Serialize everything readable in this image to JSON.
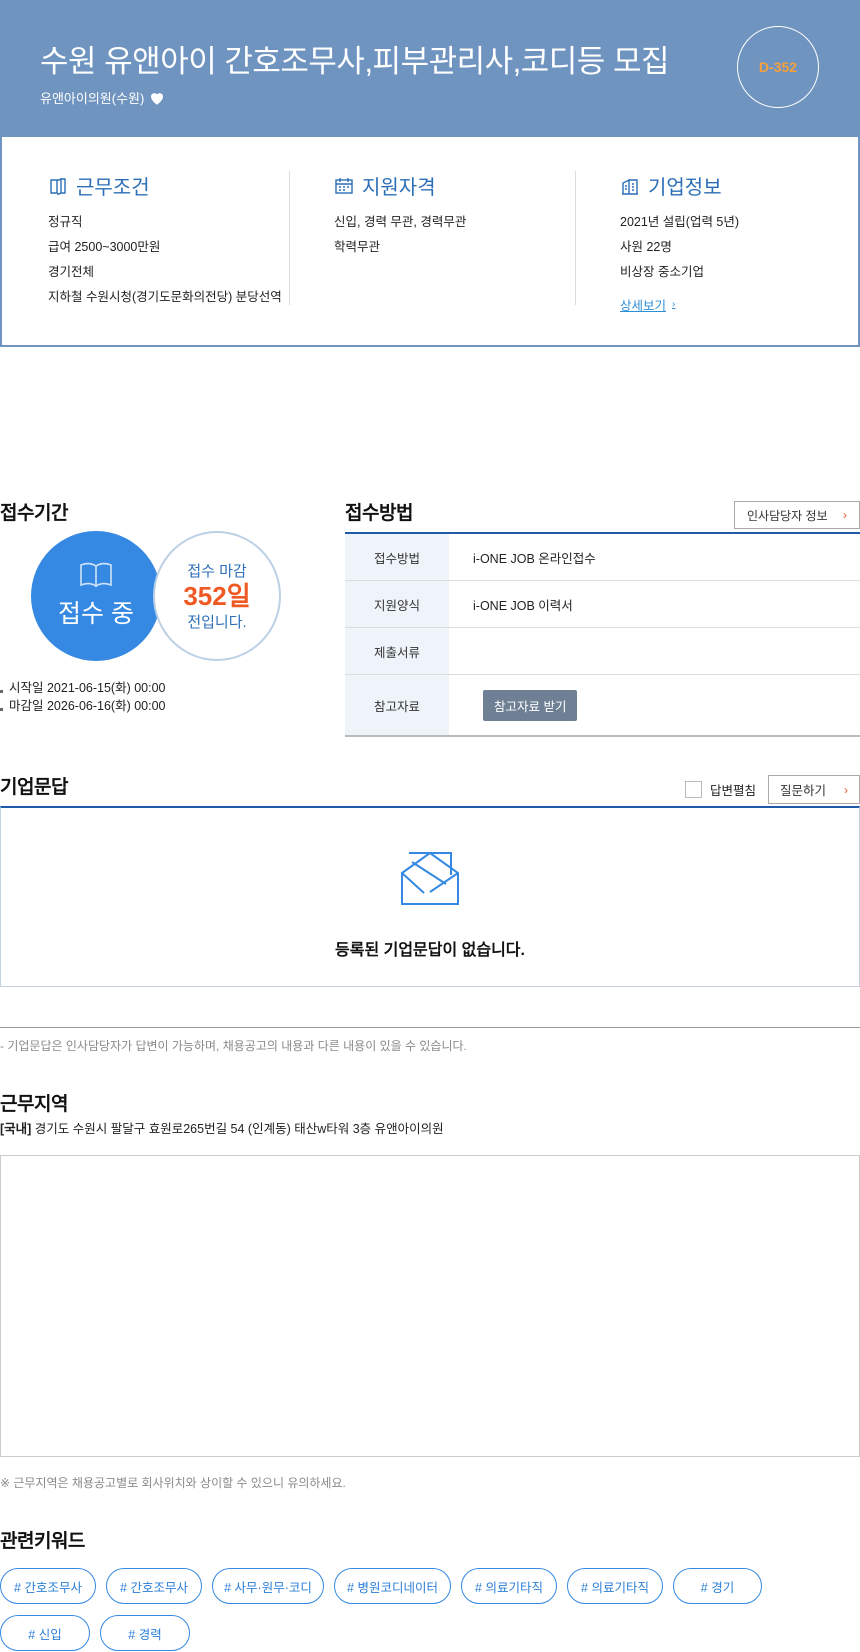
{
  "header": {
    "title": "수원 유앤아이 간호조무사,피부관리사,코디등 모집",
    "company": "유앤아이의원(수원)",
    "dday": "D-352"
  },
  "info": {
    "work": {
      "title": "근무조건",
      "lines": [
        "정규직",
        "급여 2500~3000만원",
        "경기전체",
        "지하철 수원시청(경기도문화의전당) 분당선역"
      ]
    },
    "qual": {
      "title": "지원자격",
      "lines": [
        "신입, 경력 무관, 경력무관",
        "학력무관"
      ]
    },
    "corp": {
      "title": "기업정보",
      "lines": [
        "2021년 설립(업력 5년)",
        "사원 22명",
        "비상장 중소기업"
      ],
      "more": "상세보기"
    }
  },
  "period": {
    "title": "접수기간",
    "status": "접수 중",
    "deadline_line1": "접수 마감",
    "deadline_days": "352일",
    "deadline_line3": "전입니다.",
    "start": "시작일 2021-06-15(화) 00:00",
    "end": "마감일 2026-06-16(화) 00:00"
  },
  "method": {
    "title": "접수방법",
    "hr_button": "인사담당자 정보",
    "rows": [
      {
        "k": "접수방법",
        "v": "i-ONE JOB 온라인접수"
      },
      {
        "k": "지원양식",
        "v": "i-ONE JOB 이력서"
      },
      {
        "k": "제출서류",
        "v": ""
      },
      {
        "k": "참고자료",
        "v": ""
      }
    ],
    "ref_button": "참고자료 받기"
  },
  "qna": {
    "title": "기업문답",
    "expand_label": "답변펼침",
    "ask_button": "질문하기",
    "empty": "등록된 기업문답이 없습니다.",
    "note": "- 기업문답은 인사담당자가 답변이 가능하며, 채용공고의 내용과 다른 내용이 있을 수 있습니다."
  },
  "location": {
    "title": "근무지역",
    "tag": "[국내]",
    "address": " 경기도 수원시 팔달구 효원로265번길 54 (인계동) 태산w타워 3층 유앤아이의원",
    "note": "※ 근무지역은 채용공고별로 회사위치와 상이할 수 있으니 유의하세요."
  },
  "keywords": {
    "title": "관련키워드",
    "items": [
      "# 간호조무사",
      "# 간호조무사",
      "# 사무·원무·코디",
      "# 병원코디네이터",
      "# 의료기타직",
      "# 의료기타직",
      "# 경기",
      "# 신입",
      "# 경력"
    ]
  },
  "colors": {
    "header_bg": "#6f94bf",
    "accent_blue": "#3589e3",
    "dday_orange": "#f6a13b",
    "days_red": "#ef5a24"
  }
}
